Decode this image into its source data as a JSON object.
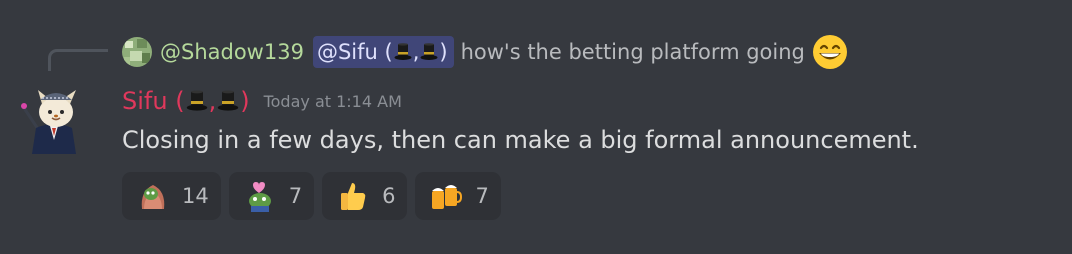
{
  "reply": {
    "author": "@Shadow139",
    "mention": {
      "prefix": "@Sifu (",
      "separator": ",",
      "suffix": ")"
    },
    "text": "how's the betting platform going",
    "emoji": "grinning-face-emoji"
  },
  "message": {
    "author": {
      "prefix": "Sifu (",
      "separator": ",",
      "suffix": ")"
    },
    "timestamp": "Today at 1:14 AM",
    "content": "Closing in a few days, then can make a big formal announcement."
  },
  "reactions": [
    {
      "emoji": "pepe-blanket-emoji",
      "count": "14"
    },
    {
      "emoji": "pepe-hearts-emoji",
      "count": "7"
    },
    {
      "emoji": "thumbs-up-emoji",
      "count": "6"
    },
    {
      "emoji": "beer-mugs-emoji",
      "count": "7"
    }
  ],
  "colors": {
    "background": "#36393f",
    "author": "#e0385c",
    "reply_author": "#b5d99b",
    "mention_bg": "#4a4f7a",
    "reaction_bg": "#2f3136"
  }
}
